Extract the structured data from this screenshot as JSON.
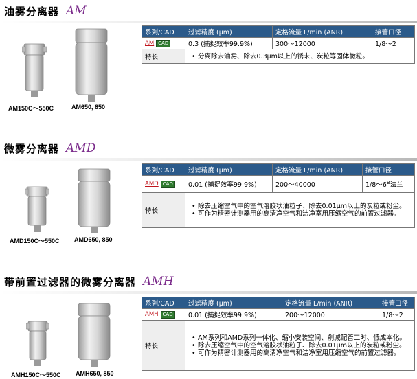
{
  "sections": [
    {
      "title_cn": "油雾分离器",
      "title_model": "AM",
      "captions": [
        "AM150C～550C",
        "AM650, 850"
      ],
      "headers": [
        "系列/CAD",
        "过滤精度 (μm)",
        "定格流量 L/min (ANR)",
        "接管口径"
      ],
      "row": {
        "model": "AM",
        "cad": "CAD",
        "precision": "0.3 (捕捉效率99.9%)",
        "flow": "300～12000",
        "port": "1/8～2"
      },
      "feature_label": "特长",
      "features": [
        "分离除去油雾、除去0.3μm以上的锈末、炭粒等固体微粒。"
      ]
    },
    {
      "title_cn": "微雾分离器",
      "title_model": "AMD",
      "captions": [
        "AMD150C～550C",
        "AMD650, 850"
      ],
      "headers": [
        "系列/CAD",
        "过滤精度 (μm)",
        "定格流量 L/min (ANR)",
        "接管口径"
      ],
      "row": {
        "model": "AMD",
        "cad": "CAD",
        "precision": "0.01 (捕捉效率99.9%)",
        "flow": "200～40000",
        "port_a": "1/8～6",
        "port_sup": "B",
        "port_b": "法兰"
      },
      "feature_label": "特长",
      "features": [
        "除去压缩空气中的空气溶胶状油粒子、除去0.01μm以上的炭粒或粉尘。",
        "可作为精密计测器用的高清净空气和洁净室用压缩空气的前置过滤器。"
      ]
    },
    {
      "title_cn": "带前置过滤器的微雾分离器",
      "title_model": "AMH",
      "captions": [
        "AMH150C～550C",
        "AMH650, 850"
      ],
      "headers": [
        "系列/CAD",
        "过滤精度 (μm)",
        "定格流量 L/min (ANR)",
        "接管口径"
      ],
      "row": {
        "model": "AMH",
        "cad": "CAD",
        "precision": "0.01 (捕捉效率99.9%)",
        "flow": "200～12000",
        "port": "1/8～2"
      },
      "feature_label": "特长",
      "features": [
        "AM系列和AMD系列一体化、缩小安装空间、削减配管工时、低成本化。",
        "除去压缩空气中的空气溶胶状油粒子、除去0.01μm以上的炭粒或粉尘。",
        "可作为精密计测器用的高清净空气和洁净室用压缩空气的前置过滤器。"
      ]
    }
  ],
  "colors": {
    "header_bg": "#2b5a8a",
    "model_accent": "#7a2a8a",
    "model_tag": "#c0141c",
    "cad_tag": "#2f7a2f"
  },
  "icons": [
    "filter-small-image",
    "filter-large-image"
  ]
}
